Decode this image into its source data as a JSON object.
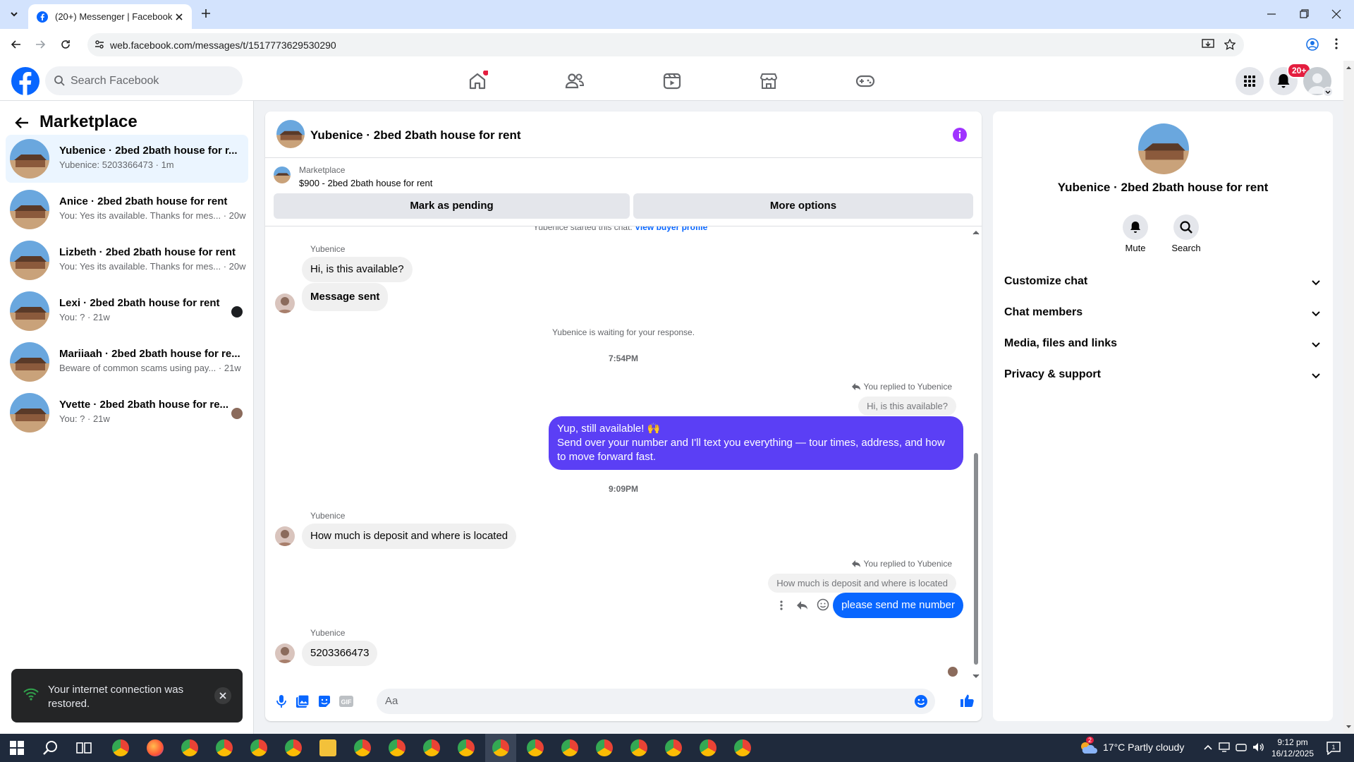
{
  "browser": {
    "tab_title": "(20+) Messenger | Facebook",
    "url": "web.facebook.com/messages/t/1517773629530290"
  },
  "header": {
    "search_placeholder": "Search Facebook",
    "notification_badge": "20+"
  },
  "sidebar": {
    "title": "Marketplace",
    "conversations": [
      {
        "name": "Yubenice · 2bed 2bath house for r...",
        "preview": "Yubenice: 5203366473 · 1m",
        "active": true
      },
      {
        "name": "Anice · 2bed 2bath house for rent",
        "preview": "You: Yes its available. Thanks for mes... · 20w"
      },
      {
        "name": "Lizbeth · 2bed 2bath house for rent",
        "preview": "You: Yes its available. Thanks for mes... · 20w"
      },
      {
        "name": "Lexi · 2bed 2bath house for rent",
        "preview": "You: ? · 21w"
      },
      {
        "name": "Mariiaah · 2bed 2bath house for re...",
        "preview": "Beware of common scams using pay... · 21w"
      },
      {
        "name": "Yvette · 2bed 2bath house for re...",
        "preview": "You: ? · 21w"
      }
    ]
  },
  "chat": {
    "title": "Yubenice · 2bed 2bath house for rent",
    "listing_source": "Marketplace",
    "listing_summary": "$900 - 2bed 2bath house for rent",
    "mark_pending": "Mark as pending",
    "more_options": "More options",
    "started_text": "Yubenice started this chat.",
    "view_buyer": "View buyer profile",
    "sender_name": "Yubenice",
    "msg1": "Hi, is this available?",
    "msg2": "Message sent",
    "waiting": "Yubenice is waiting for your response.",
    "time1": "7:54PM",
    "replied_label": "You replied to Yubenice",
    "quote1": "Hi, is this available?",
    "reply1_line1": "Yup, still available! 🙌",
    "reply1_line2": "Send over your number and I'll text you everything — tour times, address, and how",
    "reply1_line3": "to move forward fast.",
    "time2": "9:09PM",
    "msg3": "How much is deposit and where is located",
    "quote2": "How much is deposit and where is located",
    "reply2": "please send me number",
    "msg4": "5203366473",
    "composer_placeholder": "Aa"
  },
  "details": {
    "title": "Yubenice · 2bed 2bath house for rent",
    "mute": "Mute",
    "search": "Search",
    "sections": [
      "Customize chat",
      "Chat members",
      "Media, files and links",
      "Privacy & support"
    ]
  },
  "toast": {
    "message": "Your internet connection was restored."
  },
  "taskbar": {
    "weather": "17°C  Partly cloudy",
    "weather_badge": "2",
    "time": "9:12 pm",
    "date": "16/12/2025",
    "notif_count": "1"
  },
  "colors": {
    "accent": "#0866ff",
    "outgoing_bubble": "#5b3ff5",
    "notification": "#e41e3f"
  }
}
